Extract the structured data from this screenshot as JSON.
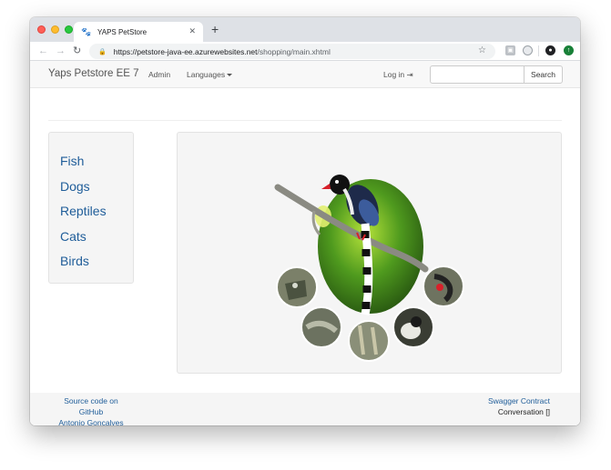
{
  "browser": {
    "tab_title": "YAPS PetStore",
    "tab_close": "✕",
    "new_tab": "+",
    "url_host": "https://petstore-java-ee.azurewebsites.net",
    "url_path": "/shopping/main.xhtml"
  },
  "navbar": {
    "brand": "Yaps Petstore EE 7",
    "admin": "Admin",
    "languages": "Languages",
    "login": "Log in",
    "search_value": "",
    "search_button": "Search"
  },
  "sidebar": {
    "categories": [
      "Fish",
      "Dogs",
      "Reptiles",
      "Cats",
      "Birds"
    ]
  },
  "footer": {
    "source_line1": "Source code on",
    "source_line2": "GitHub",
    "author": "Antonio Goncalves",
    "swagger": "Swagger Contract",
    "conversation": "Conversation []"
  },
  "icons": {
    "favicon": "dog-favicon",
    "lock": "lock-icon",
    "star": "bookmark-star-icon",
    "login": "sign-in-icon"
  },
  "colors": {
    "link": "#1f5d99",
    "navbar_bg": "#f8f8f8",
    "panel_bg": "#f5f5f5"
  }
}
